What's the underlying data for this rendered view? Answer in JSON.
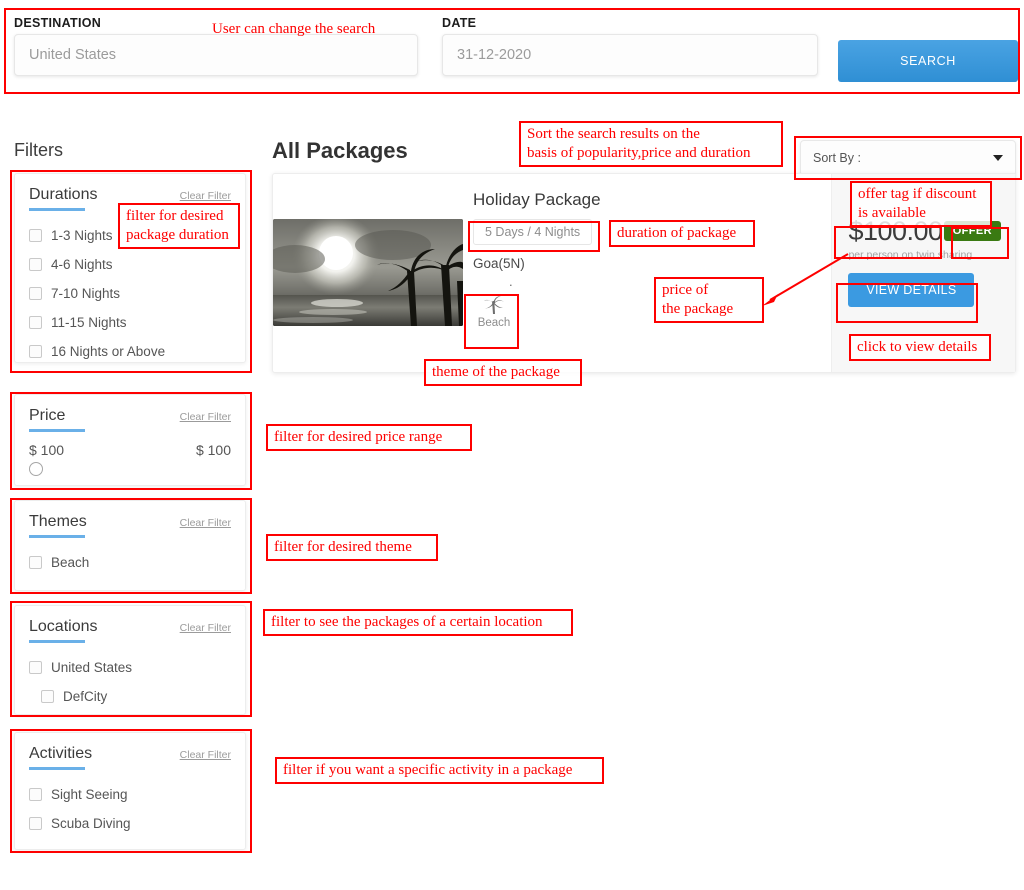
{
  "search": {
    "destination_label": "DESTINATION",
    "destination_value": "United States",
    "date_label": "DATE",
    "date_value": "31-12-2020",
    "search_button": "SEARCH"
  },
  "sidebar": {
    "title": "Filters",
    "clear_filter_label": "Clear Filter",
    "sections": [
      {
        "title": "Durations",
        "items": [
          "1-3 Nights",
          "4-6 Nights",
          "7-10 Nights",
          "11-15 Nights",
          "16 Nights or Above"
        ]
      },
      {
        "title": "Price",
        "min": "$ 100",
        "max": "$ 100"
      },
      {
        "title": "Themes",
        "items": [
          "Beach"
        ]
      },
      {
        "title": "Locations",
        "items": [
          "United States",
          "DefCity"
        ]
      },
      {
        "title": "Activities",
        "items": [
          "Sight Seeing",
          "Scuba Diving"
        ]
      }
    ]
  },
  "main": {
    "title": "All Packages",
    "sort_by": "Sort By :",
    "package": {
      "name": "Holiday Package",
      "duration": "5 Days / 4 Nights",
      "city": "Goa(5N)",
      "separator_dot": ".",
      "theme": "Beach",
      "price": "$100.00",
      "price_note": "per person on twin sharing",
      "offer_tag": "OFFER",
      "view_details": "VIEW DETAILS"
    }
  },
  "annotations": {
    "search": "User can change the search",
    "sort": "Sort the search results on the\nbasis of popularity,price and duration",
    "offer": "offer tag if discount\nis available",
    "duration": "duration of package",
    "price": "price of\nthe package",
    "view_details": "click to view details",
    "theme": "theme of the package",
    "durations_filter": "filter for desired\npackage duration",
    "price_filter": "filter for desired price range",
    "theme_filter": "filter for desired theme",
    "locations_filter": "filter to see the packages of a certain location",
    "activities_filter": "filter if you want a specific activity in a package"
  },
  "colors": {
    "annotation": "#fe0000",
    "primary": "#3b9ae1",
    "offer": "#3a7a12",
    "underline": "#6ab0e8"
  }
}
